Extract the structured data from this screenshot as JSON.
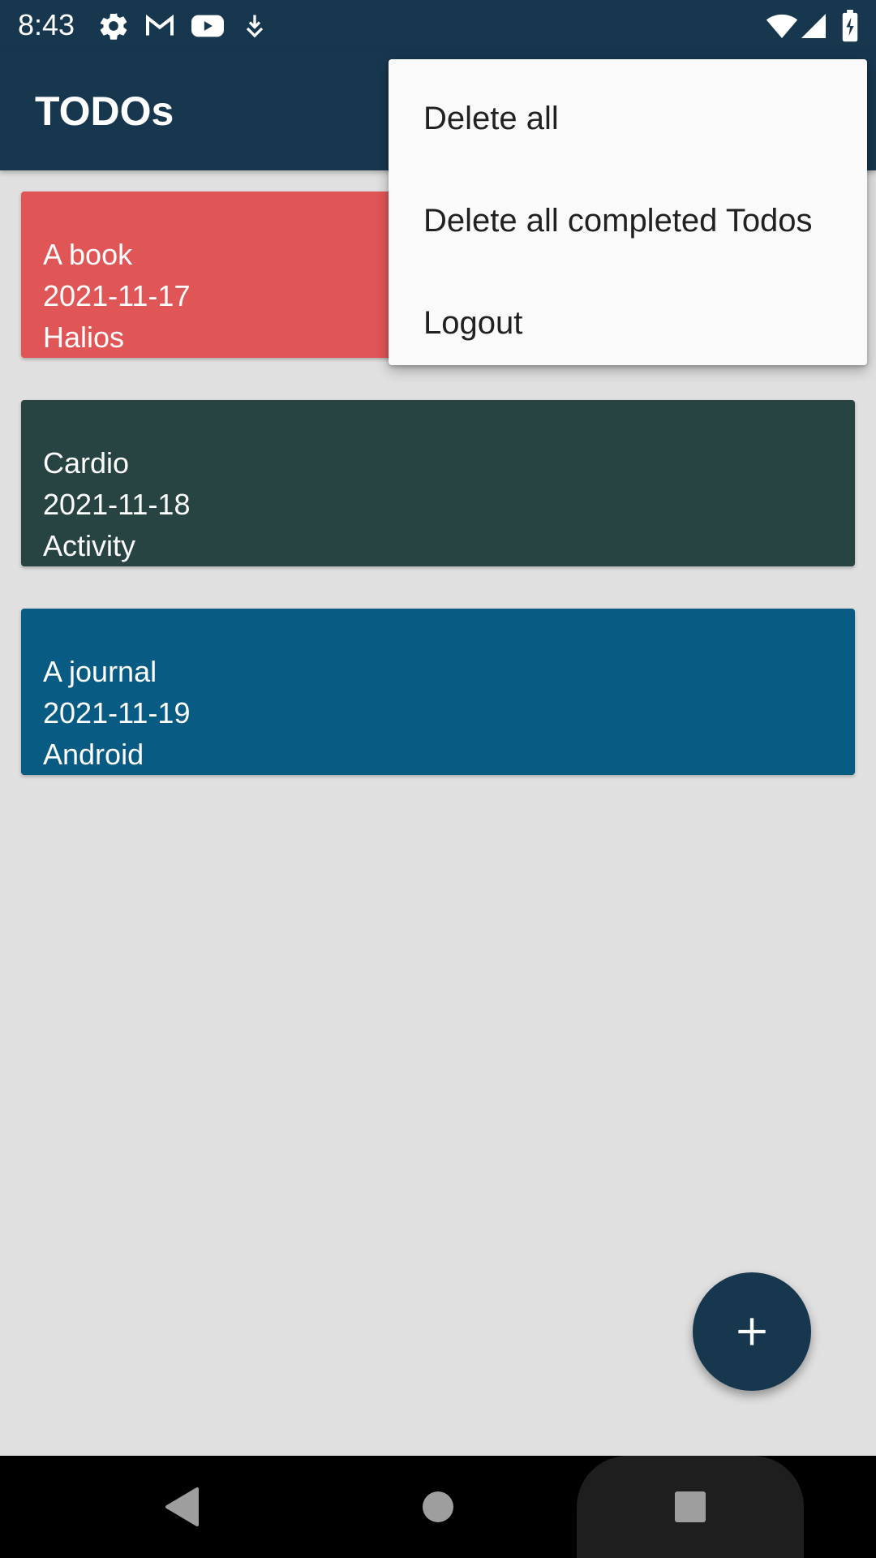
{
  "status_bar": {
    "time": "8:43",
    "left_icons": [
      "gear-icon",
      "gmail-icon",
      "youtube-icon",
      "download-icon"
    ],
    "right_icons": [
      "wifi-icon",
      "cell-signal-icon",
      "battery-charging-icon"
    ]
  },
  "app_bar": {
    "title": "TODOs"
  },
  "todos": [
    {
      "title": "A book",
      "date": "2021-11-17",
      "category": "Halios",
      "color": "#e05656"
    },
    {
      "title": "Cardio",
      "date": "2021-11-18",
      "category": "Activity",
      "color": "#284442"
    },
    {
      "title": "A journal",
      "date": "2021-11-19",
      "category": "Android",
      "color": "#085b82"
    }
  ],
  "menu": {
    "items": [
      {
        "label": "Delete all"
      },
      {
        "label": "Delete all completed Todos"
      },
      {
        "label": "Logout"
      }
    ]
  },
  "fab": {
    "icon": "plus-icon"
  },
  "nav_bar": {
    "buttons": [
      "back-icon",
      "home-icon",
      "recents-icon"
    ]
  },
  "colors": {
    "primary": "#17374f",
    "background": "#e0e0e0",
    "menu_background": "#fafafa"
  }
}
